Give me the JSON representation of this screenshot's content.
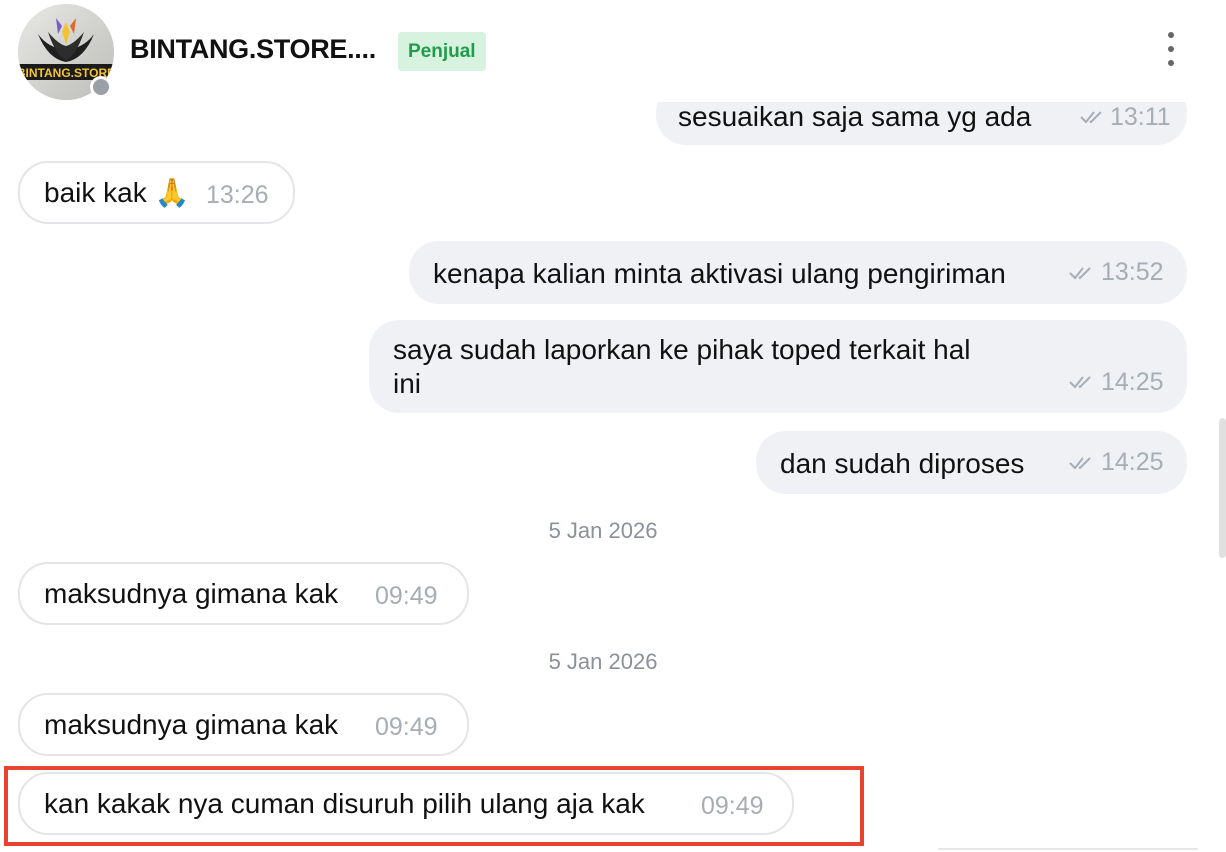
{
  "header": {
    "store_name": "BINTANG.STORE....",
    "badge": "Penjual",
    "avatar_text": "BINTANG.STORE"
  },
  "messages": [
    {
      "text": "sesuaikan saja sama yg ada",
      "time": "13:11",
      "direction": "outgoing",
      "status": "read"
    },
    {
      "text": "baik kak 🙏",
      "time": "13:26",
      "direction": "incoming"
    },
    {
      "text": "kenapa kalian minta aktivasi ulang pengiriman",
      "time": "13:52",
      "direction": "outgoing",
      "status": "read"
    },
    {
      "text_line1": "saya sudah laporkan ke pihak toped terkait hal",
      "text_line2": "ini",
      "time": "14:25",
      "direction": "outgoing",
      "status": "read"
    },
    {
      "text": "dan sudah diproses",
      "time": "14:25",
      "direction": "outgoing",
      "status": "read"
    },
    {
      "text": "maksudnya gimana kak",
      "time": "09:49",
      "direction": "incoming"
    },
    {
      "text": "maksudnya gimana kak",
      "time": "09:49",
      "direction": "incoming"
    },
    {
      "text": "kan kakak nya cuman disuruh pilih ulang aja kak",
      "time": "09:49",
      "direction": "incoming",
      "highlighted": true
    }
  ],
  "date_separators": [
    "5 Jan 2026",
    "5 Jan 2026"
  ],
  "colors": {
    "badge_bg": "#d7f2df",
    "badge_text": "#1e9e4a",
    "highlight_border": "#e8432e",
    "outgoing_bg": "#f0f1f5",
    "timestamp": "#a7adb6"
  },
  "icons": [
    "more-vertical-icon",
    "double-check-icon",
    "online-status-icon"
  ]
}
